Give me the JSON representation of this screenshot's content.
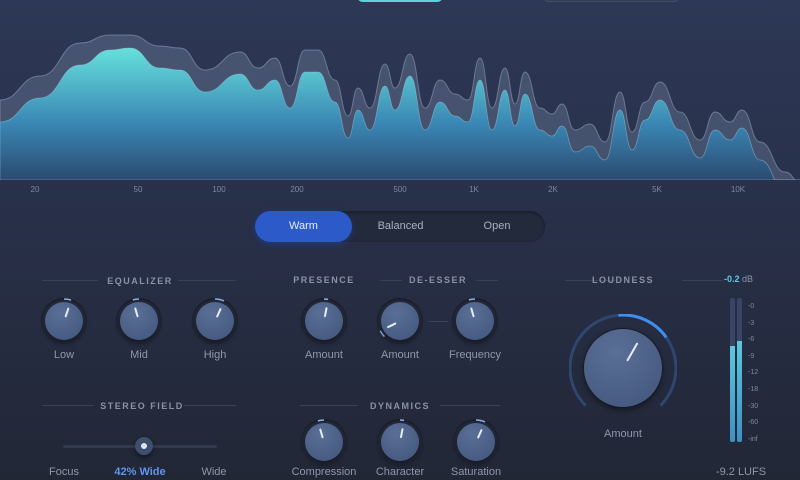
{
  "spectrum": {
    "freq_labels": [
      "20",
      "50",
      "100",
      "200",
      "500",
      "1K",
      "2K",
      "5K",
      "10K"
    ]
  },
  "presets": {
    "items": [
      "Warm",
      "Balanced",
      "Open"
    ],
    "active": "Warm"
  },
  "equalizer": {
    "title": "EQUALIZER",
    "knobs": [
      {
        "label": "Low",
        "value": 0.57
      },
      {
        "label": "Mid",
        "value": 0.44
      },
      {
        "label": "High",
        "value": 0.59
      }
    ]
  },
  "presence": {
    "title": "PRESENCE",
    "knobs": [
      {
        "label": "Amount",
        "value": 0.54
      }
    ]
  },
  "de_esser": {
    "title": "DE-ESSER",
    "knobs": [
      {
        "label": "Amount",
        "value": 0.07
      },
      {
        "label": "Frequency",
        "value": 0.44
      }
    ]
  },
  "stereo": {
    "title": "STEREO FIELD",
    "left_label": "Focus",
    "value_label": "42% Wide",
    "right_label": "Wide",
    "value": 0.42
  },
  "dynamics": {
    "title": "DYNAMICS",
    "knobs": [
      {
        "label": "Compression",
        "value": 0.44
      },
      {
        "label": "Character",
        "value": 0.54
      },
      {
        "label": "Saturation",
        "value": 0.59
      }
    ]
  },
  "loudness": {
    "title": "LOUDNESS",
    "knob_label": "Amount",
    "value": 0.61,
    "readout": "-9.2 LUFS"
  },
  "meter": {
    "peak_value": "-0.2",
    "peak_unit": "dB",
    "scale": [
      "-0",
      "-3",
      "-6",
      "-9",
      "-12",
      "-18",
      "-30",
      "-60",
      "-inf"
    ],
    "left_level": 0.67,
    "right_level": 0.7
  },
  "colors": {
    "accent": "#2c5bc9",
    "cyan": "#5cd6da"
  }
}
